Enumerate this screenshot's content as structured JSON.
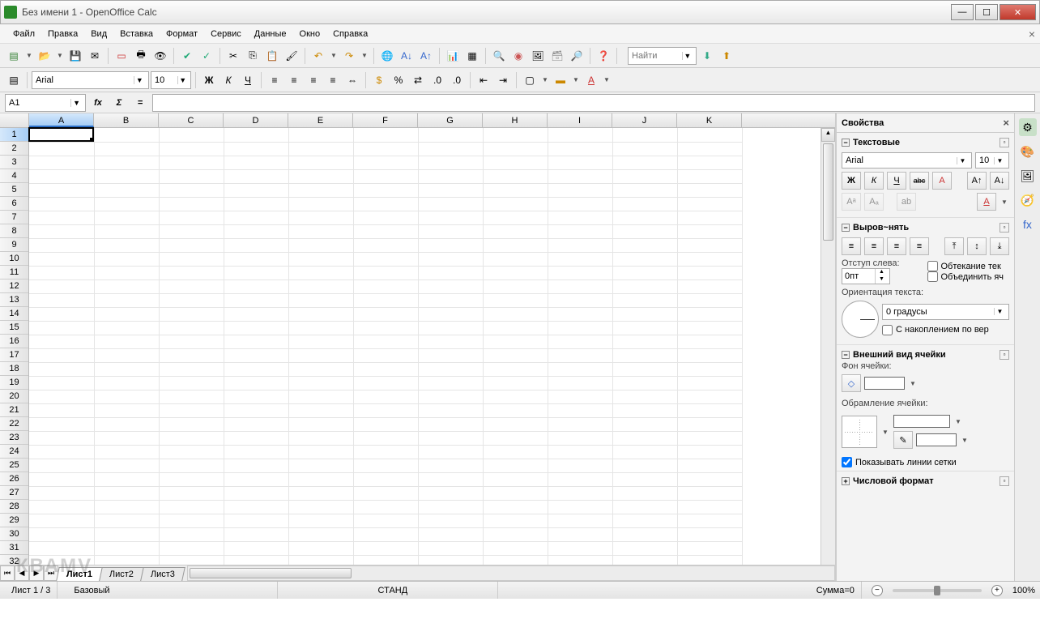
{
  "window": {
    "title": "Без имени 1 - OpenOffice Calc"
  },
  "menu": {
    "items": [
      "Файл",
      "Правка",
      "Вид",
      "Вставка",
      "Формат",
      "Сервис",
      "Данные",
      "Окно",
      "Справка"
    ]
  },
  "toolbar2": {
    "font_name": "Arial",
    "font_size": "10",
    "bold": "Ж",
    "italic": "К",
    "underline": "Ч"
  },
  "search": {
    "placeholder": "Найти"
  },
  "formulabar": {
    "cell_ref": "A1",
    "fx": "fx",
    "sigma": "Σ",
    "eq": "=",
    "formula": ""
  },
  "columns": [
    "A",
    "B",
    "C",
    "D",
    "E",
    "F",
    "G",
    "H",
    "I",
    "J",
    "K"
  ],
  "row_count": 32,
  "selected": {
    "col": 0,
    "row": 0
  },
  "sheets": {
    "nav": [
      "⏮",
      "◀",
      "▶",
      "⏭"
    ],
    "tabs": [
      "Лист1",
      "Лист2",
      "Лист3"
    ],
    "active": 0
  },
  "sidebar": {
    "title": "Свойства",
    "text_section": {
      "title": "Текстовые",
      "font_name": "Arial",
      "font_size": "10",
      "bold": "Ж",
      "italic": "К",
      "underline": "Ч",
      "strike": "abc"
    },
    "align_section": {
      "title": "Выров~нять",
      "indent_label": "Отступ слева:",
      "indent_value": "0пт",
      "wrap_label": "Обтекание тек",
      "merge_label": "Объединить яч",
      "orient_label": "Ориентация текста:",
      "orient_value": "0 градусы",
      "stack_label": "С накоплением по вер"
    },
    "appearance_section": {
      "title": "Внешний вид ячейки",
      "bg_label": "Фон ячейки:",
      "border_label": "Обрамление ячейки:",
      "gridlines_label": "Показывать линии сетки",
      "gridlines_checked": true
    },
    "number_section": {
      "title": "Числовой формат"
    }
  },
  "statusbar": {
    "sheet_info": "Лист 1 / 3",
    "style": "Базовый",
    "mode": "СТАНД",
    "sum": "Сумма=0",
    "zoom": "100%"
  },
  "watermark": "КВАМV"
}
